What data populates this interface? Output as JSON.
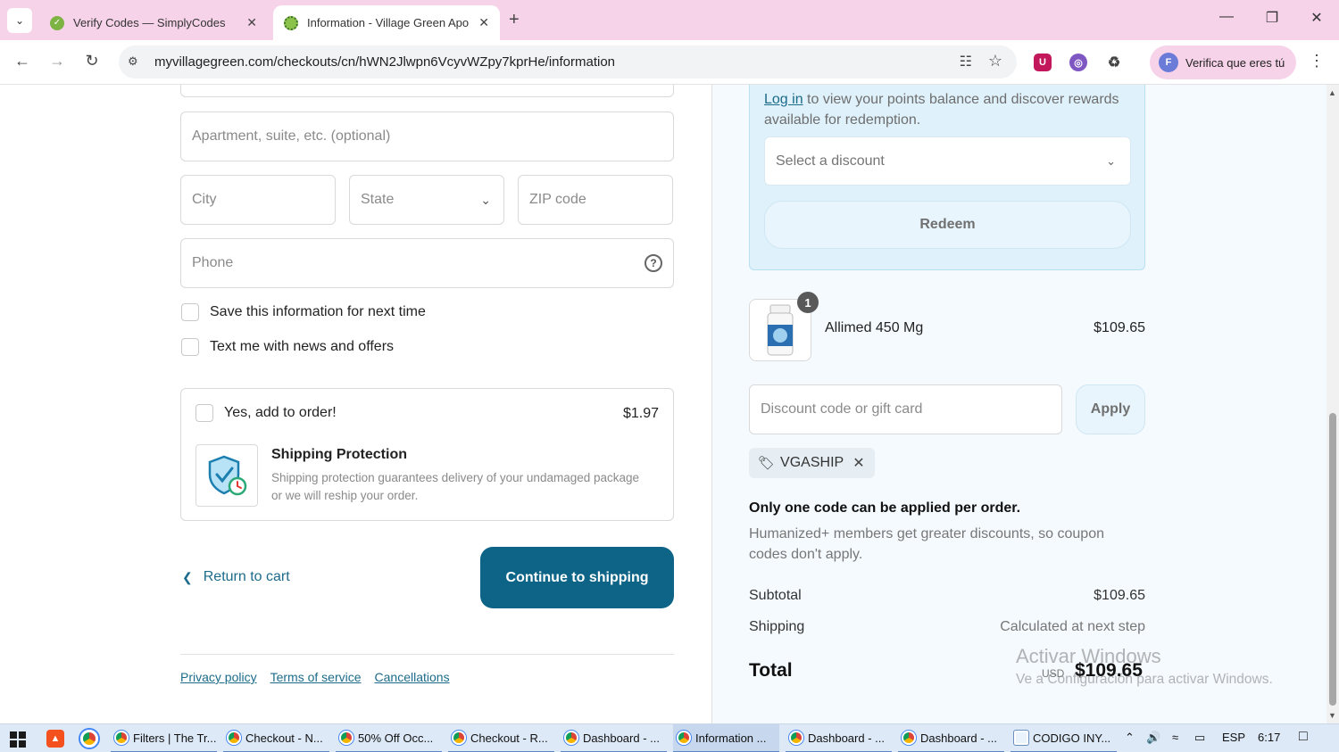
{
  "browser": {
    "tabs": [
      {
        "title": "Verify Codes — SimplyCodes",
        "active": false
      },
      {
        "title": "Information - Village Green Apo",
        "active": true
      }
    ],
    "url": "myvillagegreen.com/checkouts/cn/hWN2Jlwpn6VcyvWZpy7kprHe/information",
    "profile_label": "Verifica que eres tú",
    "profile_initial": "F"
  },
  "form": {
    "apartment_placeholder": "Apartment, suite, etc. (optional)",
    "city_placeholder": "City",
    "state_placeholder": "State",
    "zip_placeholder": "ZIP code",
    "phone_placeholder": "Phone",
    "save_info_label": "Save this information for next time",
    "text_me_label": "Text me with news and offers"
  },
  "protection": {
    "add_label": "Yes, add to order!",
    "price": "$1.97",
    "title": "Shipping Protection",
    "description": "Shipping protection guarantees delivery of your undamaged package or we will reship your order."
  },
  "actions": {
    "return_label": "Return to cart",
    "continue_label": "Continue to shipping"
  },
  "footer_links": [
    "Privacy policy",
    "Terms of service",
    "Cancellations"
  ],
  "rewards": {
    "login_link": "Log in",
    "message": " to view your points balance and discover rewards available for redemption.",
    "select_placeholder": "Select a discount",
    "redeem_label": "Redeem"
  },
  "product": {
    "quantity": "1",
    "name": "Allimed 450 Mg",
    "price": "$109.65"
  },
  "discount": {
    "placeholder": "Discount code or gift card",
    "apply_label": "Apply",
    "applied_code": "VGASHIP",
    "notice_title": "Only one code can be applied per order.",
    "notice_text": "Humanized+ members get greater discounts, so coupon codes don't apply."
  },
  "summary": {
    "subtotal_label": "Subtotal",
    "subtotal_value": "$109.65",
    "shipping_label": "Shipping",
    "shipping_value": "Calculated at next step",
    "total_label": "Total",
    "currency": "USD",
    "total_value": "$109.65"
  },
  "watermark": {
    "line1": "Activar Windows",
    "line2": "Ve a Configuración para activar Windows."
  },
  "taskbar": {
    "items": [
      {
        "label": "Filters | The Tr...",
        "active": false
      },
      {
        "label": "Checkout - N...",
        "active": false
      },
      {
        "label": "50% Off Occ...",
        "active": false
      },
      {
        "label": "Checkout - R...",
        "active": false
      },
      {
        "label": "Dashboard - ...",
        "active": false
      },
      {
        "label": "Information ...",
        "active": true
      },
      {
        "label": "Dashboard - ...",
        "active": false
      },
      {
        "label": "Dashboard - ...",
        "active": false
      },
      {
        "label": "CODIGO INY...",
        "active": false
      }
    ],
    "language": "ESP",
    "time": "6:17"
  },
  "colors": {
    "tabbar_bg": "#f7d3ea",
    "primary_button": "#0e6487",
    "link": "#1c6b8a",
    "rewards_panel": "#dff1fb"
  },
  "icons": {
    "tab1_favicon": "check-leaf-icon",
    "tab2_favicon": "sun-logo-icon",
    "help": "question-circle-icon",
    "tag": "tag-icon",
    "remove": "close-icon"
  }
}
